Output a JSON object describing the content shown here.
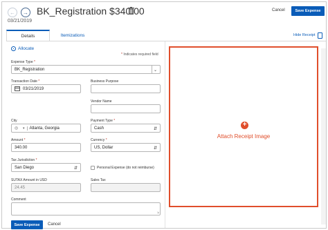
{
  "header": {
    "title": "BK_Registration $340.00",
    "date": "03/21/2019",
    "cancel_label": "Cancel",
    "save_label": "Save Expense"
  },
  "tabs": [
    {
      "label": "Details",
      "active": true
    },
    {
      "label": "Itemizations",
      "active": false
    }
  ],
  "hide_receipt_label": "Hide Receipt",
  "form": {
    "allocate_label": "Allocate",
    "required_note": "Indicates required field",
    "expense_type": {
      "label": "Expense Type",
      "value": "BK_Registration"
    },
    "transaction_date": {
      "label": "Transaction Date",
      "value": "03/21/2019"
    },
    "business_purpose": {
      "label": "Business Purpose",
      "value": ""
    },
    "vendor_name": {
      "label": "Vendor Name",
      "value": ""
    },
    "city": {
      "label": "City",
      "value": "Atlanta, Georgia"
    },
    "payment_type": {
      "label": "Payment Type",
      "value": "Cash"
    },
    "amount": {
      "label": "Amount",
      "value": "340.00"
    },
    "currency": {
      "label": "Currency",
      "value": "US, Dollar"
    },
    "tax_jurisdiction": {
      "label": "Tax Jurisdiction",
      "value": "San Diego"
    },
    "personal_expense": {
      "label": "Personal Expense (do not reimburse)",
      "checked": false
    },
    "sutax": {
      "label": "SUTAX Amount in USD",
      "value": "24.45"
    },
    "sales_tax": {
      "label": "Sales Tax",
      "value": ""
    },
    "comment": {
      "label": "Comment",
      "value": ""
    }
  },
  "footer": {
    "save_label": "Save Expense",
    "cancel_label": "Cancel"
  },
  "receipt": {
    "attach_label": "Attach Receipt Image"
  },
  "colors": {
    "primary": "#0a5cb8",
    "accent": "#e04e2b",
    "required": "#c0392b"
  }
}
